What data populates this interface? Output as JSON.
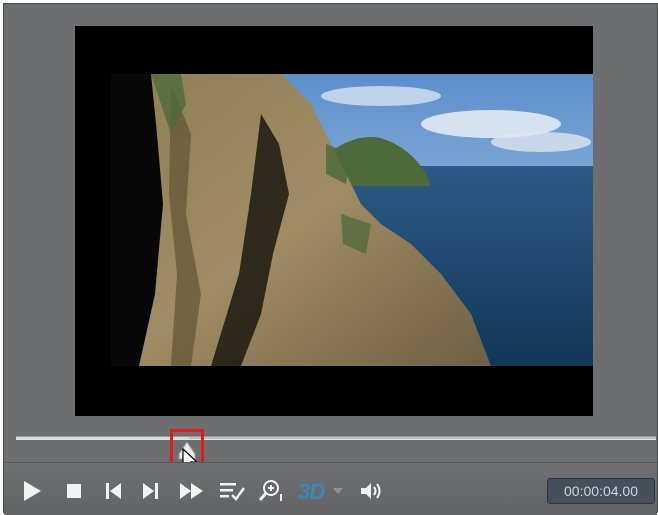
{
  "player": {
    "time_display": "00:00:04.00",
    "playback_progress": 0.27,
    "threed_label": "3D"
  },
  "controls": [
    {
      "name": "play-icon"
    },
    {
      "name": "stop-icon"
    },
    {
      "name": "previous-icon"
    },
    {
      "name": "next-icon"
    },
    {
      "name": "fast-forward-icon"
    },
    {
      "name": "playlist-icon"
    },
    {
      "name": "zoom-icon"
    },
    {
      "name": "3d-toggle"
    },
    {
      "name": "volume-icon"
    }
  ],
  "colors": {
    "player_bg": "#6d6e70",
    "accent_3d": "#3d86b8",
    "highlight_box": "#e21a1a",
    "time_text": "#c4d9ea"
  }
}
